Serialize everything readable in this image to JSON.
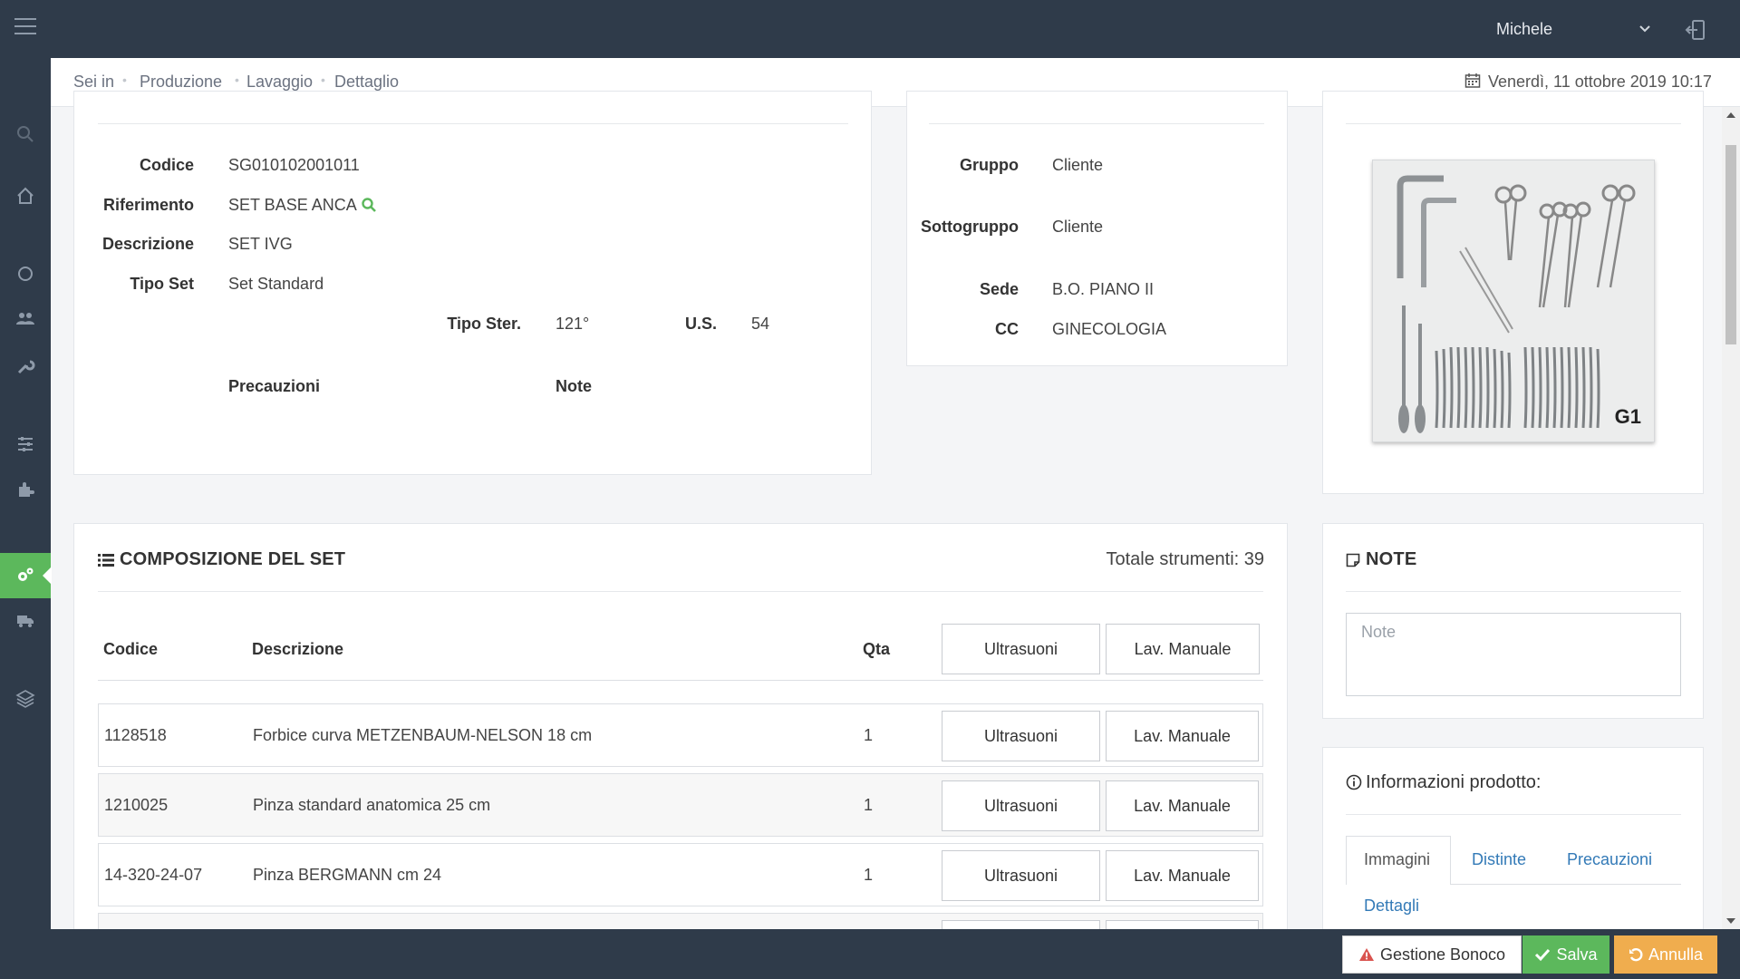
{
  "header": {
    "user_name": "Michele"
  },
  "breadcrumb": {
    "items": [
      "Sei in",
      "Produzione",
      "Lavaggio",
      "Dettaglio"
    ],
    "date": "Venerdì, 11 ottobre 2019 10:17"
  },
  "set_info": {
    "codice_label": "Codice",
    "codice": "SG010102001011",
    "riferimento_label": "Riferimento",
    "riferimento": "SET BASE ANCA",
    "descrizione_label": "Descrizione",
    "descrizione": "SET IVG",
    "tipo_set_label": "Tipo Set",
    "tipo_set": "Set Standard",
    "tipo_ster_label": "Tipo Ster.",
    "tipo_ster": "121°",
    "us_label": "U.S.",
    "us": "54",
    "precauzioni_label": "Precauzioni",
    "note_label": "Note"
  },
  "client_info": {
    "gruppo_label": "Gruppo",
    "gruppo": "Cliente",
    "sottogruppo_label": "Sottogruppo",
    "sottogruppo": "Cliente",
    "sede_label": "Sede",
    "sede": "B.O. PIANO II",
    "cc_label": "CC",
    "cc": "GINECOLOGIA"
  },
  "image": {
    "label": "G1"
  },
  "composition": {
    "title": "COMPOSIZIONE DEL SET",
    "total": "Totale strumenti: 39",
    "columns": {
      "codice": "Codice",
      "descrizione": "Descrizione",
      "qta": "Qta"
    },
    "header_buttons": {
      "ultrasuoni": "Ultrasuoni",
      "manuale": "Lav. Manuale"
    },
    "rows": [
      {
        "codice": "1128518",
        "descrizione": "Forbice curva METZENBAUM-NELSON 18 cm",
        "qta": "1",
        "btn1": "Ultrasuoni",
        "btn2": "Lav. Manuale"
      },
      {
        "codice": "1210025",
        "descrizione": "Pinza standard anatomica 25 cm",
        "qta": "1",
        "btn1": "Ultrasuoni",
        "btn2": "Lav. Manuale"
      },
      {
        "codice": "14-320-24-07",
        "descrizione": "Pinza BERGMANN cm 24",
        "qta": "1",
        "btn1": "Ultrasuoni",
        "btn2": "Lav. Manuale"
      }
    ]
  },
  "notes": {
    "title": "NOTE",
    "placeholder": "Note"
  },
  "product_info": {
    "title": "Informazioni prodotto:",
    "tabs": [
      "Immagini",
      "Distinte",
      "Precauzioni",
      "Dettagli"
    ]
  },
  "footer": {
    "gestione": "Gestione Bonoco",
    "salva": "Salva",
    "annulla": "Annulla"
  },
  "colors": {
    "topbar": "#2f3b4a",
    "accent_green": "#5cb85c",
    "warning_orange": "#f0ad4e",
    "danger_red": "#d9534f",
    "link_blue": "#337ab7"
  }
}
